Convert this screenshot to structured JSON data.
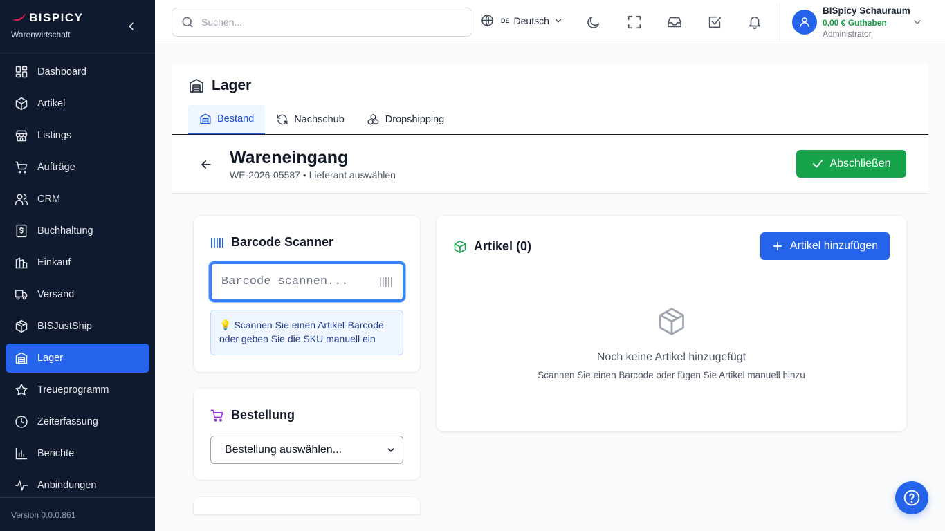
{
  "brand": {
    "name": "BISPICY",
    "subtitle": "Warenwirtschaft"
  },
  "sidebar": {
    "items": [
      {
        "label": "Dashboard",
        "icon": "dashboard-icon",
        "active": false
      },
      {
        "label": "Artikel",
        "icon": "package-icon",
        "active": false
      },
      {
        "label": "Listings",
        "icon": "store-icon",
        "active": false
      },
      {
        "label": "Aufträge",
        "icon": "cart-icon",
        "active": false
      },
      {
        "label": "CRM",
        "icon": "users-icon",
        "active": false
      },
      {
        "label": "Buchhaltung",
        "icon": "receipt-icon",
        "active": false
      },
      {
        "label": "Einkauf",
        "icon": "building-icon",
        "active": false
      },
      {
        "label": "Versand",
        "icon": "truck-icon",
        "active": false
      },
      {
        "label": "BISJustShip",
        "icon": "package-icon",
        "active": false
      },
      {
        "label": "Lager",
        "icon": "warehouse-icon",
        "active": true
      },
      {
        "label": "Treueprogramm",
        "icon": "star-icon",
        "active": false
      },
      {
        "label": "Zeiterfassung",
        "icon": "clock-icon",
        "active": false
      },
      {
        "label": "Berichte",
        "icon": "bar-chart-icon",
        "active": false
      },
      {
        "label": "Anbindungen",
        "icon": "activity-icon",
        "active": false
      }
    ],
    "version": "Version 0.0.0.861"
  },
  "topbar": {
    "search_placeholder": "Suchen...",
    "language_code": "DE",
    "language_name": "Deutsch",
    "user_name": "BISpicy Schauraum",
    "user_credit": "0,00 € Guthaben",
    "user_role": "Administrator"
  },
  "page": {
    "title": "Lager",
    "tabs": [
      {
        "label": "Bestand",
        "active": true
      },
      {
        "label": "Nachschub",
        "active": false
      },
      {
        "label": "Dropshipping",
        "active": false
      }
    ],
    "doc_title": "Wareneingang",
    "doc_subtitle": "WE-2026-05587 • Lieferant auswählen",
    "finish_label": "Abschließen"
  },
  "scanner": {
    "title": "Barcode Scanner",
    "placeholder": "Barcode scannen...",
    "hint_bulb": "💡",
    "hint": "Scannen Sie einen Artikel-Barcode oder geben Sie die SKU manuell ein"
  },
  "order": {
    "title": "Bestellung",
    "select_value": "Bestellung auswählen..."
  },
  "articles": {
    "title": "Artikel (0)",
    "add_label": "Artikel hinzufügen",
    "empty_title": "Noch keine Artikel hinzugefügt",
    "empty_subtitle": "Scannen Sie einen Barcode oder fügen Sie Artikel manuell hinzu"
  },
  "colors": {
    "sidebar_bg": "#0f1a2e",
    "accent": "#2563eb",
    "success": "#16a34a"
  }
}
